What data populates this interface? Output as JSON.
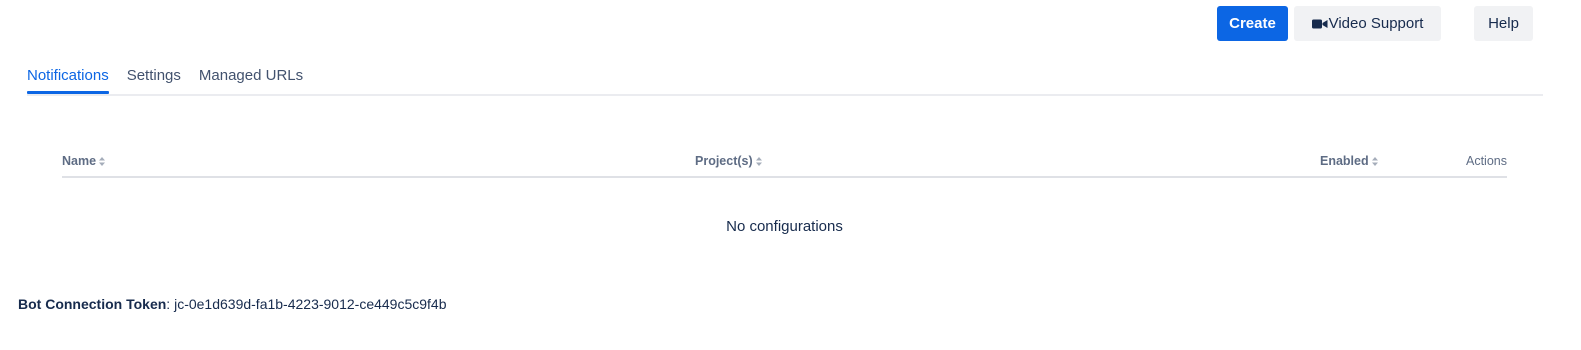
{
  "toolbar": {
    "create_label": "Create",
    "video_support_label": "Video Support",
    "help_label": "Help",
    "primary_color": "#0c66e4"
  },
  "tabs": [
    {
      "label": "Notifications",
      "active": true
    },
    {
      "label": "Settings",
      "active": false
    },
    {
      "label": "Managed URLs",
      "active": false
    }
  ],
  "table": {
    "columns": [
      {
        "label": "Name",
        "sortable": true
      },
      {
        "label": "Project(s)",
        "sortable": true
      },
      {
        "label": "Enabled",
        "sortable": true
      },
      {
        "label": "Actions",
        "sortable": false
      }
    ],
    "empty_text": "No configurations"
  },
  "footer": {
    "token_label": "Bot Connection Token",
    "token_separator": ": ",
    "token_value": "jc-0e1d639d-fa1b-4223-9012-ce449c5c9f4b"
  },
  "icons": {
    "video": "video-camera-icon",
    "sort": "sort-icon"
  }
}
